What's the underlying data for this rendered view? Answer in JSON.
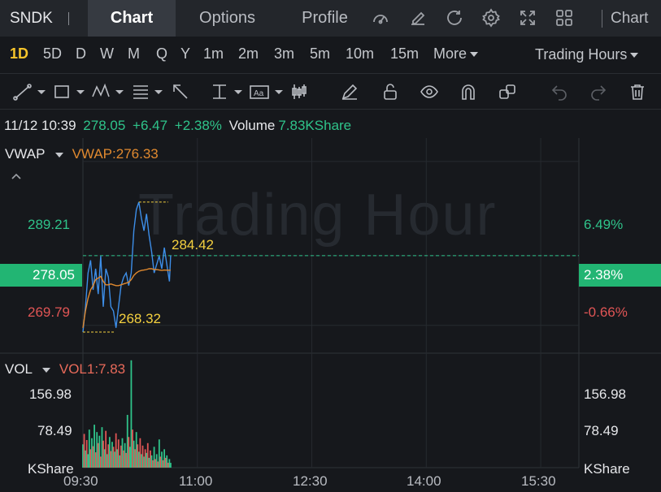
{
  "header": {
    "ticker": "SNDK",
    "tabs": [
      "Chart",
      "Options",
      "Profile"
    ],
    "active_tab": "Chart",
    "chart_tab_partial": "Chart",
    "icons": [
      "gauge-icon",
      "edit-icon",
      "refresh-icon",
      "settings-icon",
      "fullscreen-icon",
      "grid-icon"
    ]
  },
  "periods": {
    "items": [
      "1D",
      "5D",
      "D",
      "W",
      "M",
      "Q",
      "Y",
      "1m",
      "2m",
      "3m",
      "5m",
      "10m",
      "15m"
    ],
    "active": "1D",
    "more_label": "More",
    "session_label": "Trading Hours"
  },
  "drawing_tools": [
    "line-tool-icon",
    "rectangle-tool-icon",
    "pattern-tool-icon",
    "fibonacci-tool-icon",
    "arrow-tool-icon",
    "measure-tool-icon",
    "text-tool-icon",
    "candle-tool-icon",
    "pencil-icon",
    "unlock-icon",
    "eye-icon",
    "magnet-icon",
    "copy-icon",
    "undo-icon",
    "redo-icon",
    "trash-icon"
  ],
  "quote": {
    "datetime": "11/12 10:39",
    "price": "278.05",
    "change": "+6.47",
    "change_pct": "+2.38%",
    "volume_label": "Volume",
    "volume": "7.83KShare"
  },
  "main_panel": {
    "indicator": "VWAP",
    "indicator_value": "VWAP:276.33",
    "watermark": "Trading Hour",
    "y_left": [
      "289.21",
      "278.05",
      "269.79"
    ],
    "y_right": [
      "6.49%",
      "2.38%",
      "-0.66%"
    ],
    "high_label": "284.42",
    "low_label": "268.32"
  },
  "volume_panel": {
    "indicator": "VOL",
    "indicator_value": "VOL1:7.83",
    "y_left": [
      "156.98",
      "78.49",
      "KShare"
    ],
    "y_right": [
      "156.98",
      "78.49",
      "KShare"
    ]
  },
  "x_axis": [
    "09:30",
    "11:00",
    "12:30",
    "14:00",
    "15:30"
  ],
  "colors": {
    "up": "#2fc38a",
    "down": "#e05555",
    "accent": "#f6c42b",
    "price_line": "#3d8ee8",
    "vwap_line": "#e0892f",
    "price_box": "#22b573"
  },
  "chart_data": {
    "type": "line",
    "x_range": [
      "09:30",
      "16:00"
    ],
    "ylim": [
      266.5,
      291.5
    ],
    "series": [
      {
        "name": "",
        "x": [
          "09:30",
          "09:32",
          "09:34",
          "09:36",
          "09:38",
          "09:40",
          "09:42",
          "09:44",
          "09:46",
          "09:48",
          "09:50",
          "09:52",
          "09:54",
          "09:56",
          "09:58",
          "10:00",
          "10:02",
          "10:04",
          "10:06",
          "10:08",
          "10:10",
          "10:12",
          "10:14",
          "10:16",
          "10:18",
          "10:20",
          "10:22",
          "10:24",
          "10:26",
          "10:28",
          "10:30",
          "10:32",
          "10:34",
          "10:36",
          "10:38",
          "10:39"
        ],
        "values": [
          269.0,
          272.0,
          276.0,
          277.5,
          274.0,
          276.5,
          273.5,
          278.0,
          272.0,
          276.5,
          275.5,
          272.0,
          271.5,
          269.5,
          272.0,
          274.5,
          275.5,
          276.0,
          274.5,
          276.0,
          281.0,
          283.5,
          284.4,
          282.5,
          281.0,
          283.0,
          280.5,
          278.5,
          276.0,
          277.0,
          278.0,
          276.5,
          279.0,
          277.0,
          275.0,
          278.05
        ]
      },
      {
        "name": "VWAP",
        "x": [
          "09:30",
          "09:32",
          "09:34",
          "09:36",
          "09:38",
          "09:40",
          "09:42",
          "09:44",
          "09:46",
          "09:48",
          "09:50",
          "09:52",
          "09:54",
          "09:56",
          "09:58",
          "10:00",
          "10:02",
          "10:04",
          "10:06",
          "10:08",
          "10:10",
          "10:12",
          "10:14",
          "10:16",
          "10:18",
          "10:20",
          "10:22",
          "10:24",
          "10:26",
          "10:28",
          "10:30",
          "10:32",
          "10:34",
          "10:36",
          "10:38",
          "10:39"
        ],
        "values": [
          269.5,
          271.5,
          273.0,
          274.0,
          274.5,
          275.2,
          275.4,
          275.6,
          275.0,
          274.6,
          274.6,
          274.7,
          274.6,
          274.5,
          274.5,
          274.6,
          274.7,
          274.8,
          274.9,
          275.2,
          275.7,
          276.0,
          276.2,
          276.3,
          276.35,
          276.4,
          276.5,
          276.5,
          276.4,
          276.4,
          276.35,
          276.3,
          276.35,
          276.33,
          276.33,
          276.33
        ]
      }
    ],
    "volume": {
      "unit": "KShare",
      "ylim": [
        0,
        180
      ],
      "bars": [
        {
          "x": "09:30",
          "value": 38,
          "up": true
        },
        {
          "x": "09:31",
          "value": 55,
          "up": false
        },
        {
          "x": "09:32",
          "value": 28,
          "up": true
        },
        {
          "x": "09:33",
          "value": 45,
          "up": false
        },
        {
          "x": "09:34",
          "value": 22,
          "up": true
        },
        {
          "x": "09:35",
          "value": 62,
          "up": true
        },
        {
          "x": "09:36",
          "value": 30,
          "up": false
        },
        {
          "x": "09:37",
          "value": 48,
          "up": true
        },
        {
          "x": "09:38",
          "value": 35,
          "up": false
        },
        {
          "x": "09:39",
          "value": 70,
          "up": true
        },
        {
          "x": "09:40",
          "value": 25,
          "up": false
        },
        {
          "x": "09:41",
          "value": 58,
          "up": true
        },
        {
          "x": "09:42",
          "value": 40,
          "up": false
        },
        {
          "x": "09:43",
          "value": 52,
          "up": true
        },
        {
          "x": "09:44",
          "value": 18,
          "up": false
        },
        {
          "x": "09:45",
          "value": 66,
          "up": true
        },
        {
          "x": "09:46",
          "value": 44,
          "up": false
        },
        {
          "x": "09:47",
          "value": 30,
          "up": true
        },
        {
          "x": "09:48",
          "value": 60,
          "up": false
        },
        {
          "x": "09:49",
          "value": 22,
          "up": true
        },
        {
          "x": "09:50",
          "value": 38,
          "up": false
        },
        {
          "x": "09:51",
          "value": 50,
          "up": true
        },
        {
          "x": "09:52",
          "value": 27,
          "up": false
        },
        {
          "x": "09:53",
          "value": 42,
          "up": true
        },
        {
          "x": "09:54",
          "value": 34,
          "up": false
        },
        {
          "x": "09:55",
          "value": 26,
          "up": true
        },
        {
          "x": "09:56",
          "value": 56,
          "up": false
        },
        {
          "x": "09:57",
          "value": 30,
          "up": true
        },
        {
          "x": "09:58",
          "value": 46,
          "up": false
        },
        {
          "x": "09:59",
          "value": 20,
          "up": true
        },
        {
          "x": "10:00",
          "value": 36,
          "up": false
        },
        {
          "x": "10:01",
          "value": 48,
          "up": true
        },
        {
          "x": "10:02",
          "value": 28,
          "up": false
        },
        {
          "x": "10:03",
          "value": 40,
          "up": true
        },
        {
          "x": "10:04",
          "value": 24,
          "up": false
        },
        {
          "x": "10:05",
          "value": 86,
          "up": true
        },
        {
          "x": "10:06",
          "value": 50,
          "up": false
        },
        {
          "x": "10:07",
          "value": 34,
          "up": true
        },
        {
          "x": "10:08",
          "value": 175,
          "up": true
        },
        {
          "x": "10:09",
          "value": 62,
          "up": false
        },
        {
          "x": "10:10",
          "value": 44,
          "up": true
        },
        {
          "x": "10:11",
          "value": 30,
          "up": false
        },
        {
          "x": "10:12",
          "value": 58,
          "up": true
        },
        {
          "x": "10:13",
          "value": 38,
          "up": false
        },
        {
          "x": "10:14",
          "value": 26,
          "up": true
        },
        {
          "x": "10:15",
          "value": 48,
          "up": false
        },
        {
          "x": "10:16",
          "value": 22,
          "up": true
        },
        {
          "x": "10:17",
          "value": 36,
          "up": false
        },
        {
          "x": "10:18",
          "value": 18,
          "up": true
        },
        {
          "x": "10:19",
          "value": 30,
          "up": false
        },
        {
          "x": "10:20",
          "value": 24,
          "up": true
        },
        {
          "x": "10:21",
          "value": 40,
          "up": false
        },
        {
          "x": "10:22",
          "value": 16,
          "up": true
        },
        {
          "x": "10:23",
          "value": 28,
          "up": false
        },
        {
          "x": "10:24",
          "value": 20,
          "up": true
        },
        {
          "x": "10:25",
          "value": 12,
          "up": false
        },
        {
          "x": "10:26",
          "value": 34,
          "up": true
        },
        {
          "x": "10:27",
          "value": 14,
          "up": false
        },
        {
          "x": "10:28",
          "value": 22,
          "up": true
        },
        {
          "x": "10:29",
          "value": 10,
          "up": false
        },
        {
          "x": "10:30",
          "value": 46,
          "up": true
        },
        {
          "x": "10:31",
          "value": 18,
          "up": false
        },
        {
          "x": "10:32",
          "value": 26,
          "up": true
        },
        {
          "x": "10:33",
          "value": 12,
          "up": false
        },
        {
          "x": "10:34",
          "value": 30,
          "up": true
        },
        {
          "x": "10:35",
          "value": 16,
          "up": false
        },
        {
          "x": "10:36",
          "value": 20,
          "up": true
        },
        {
          "x": "10:37",
          "value": 8,
          "up": false
        },
        {
          "x": "10:38",
          "value": 14,
          "up": true
        },
        {
          "x": "10:39",
          "value": 7.83,
          "up": true
        }
      ]
    }
  }
}
